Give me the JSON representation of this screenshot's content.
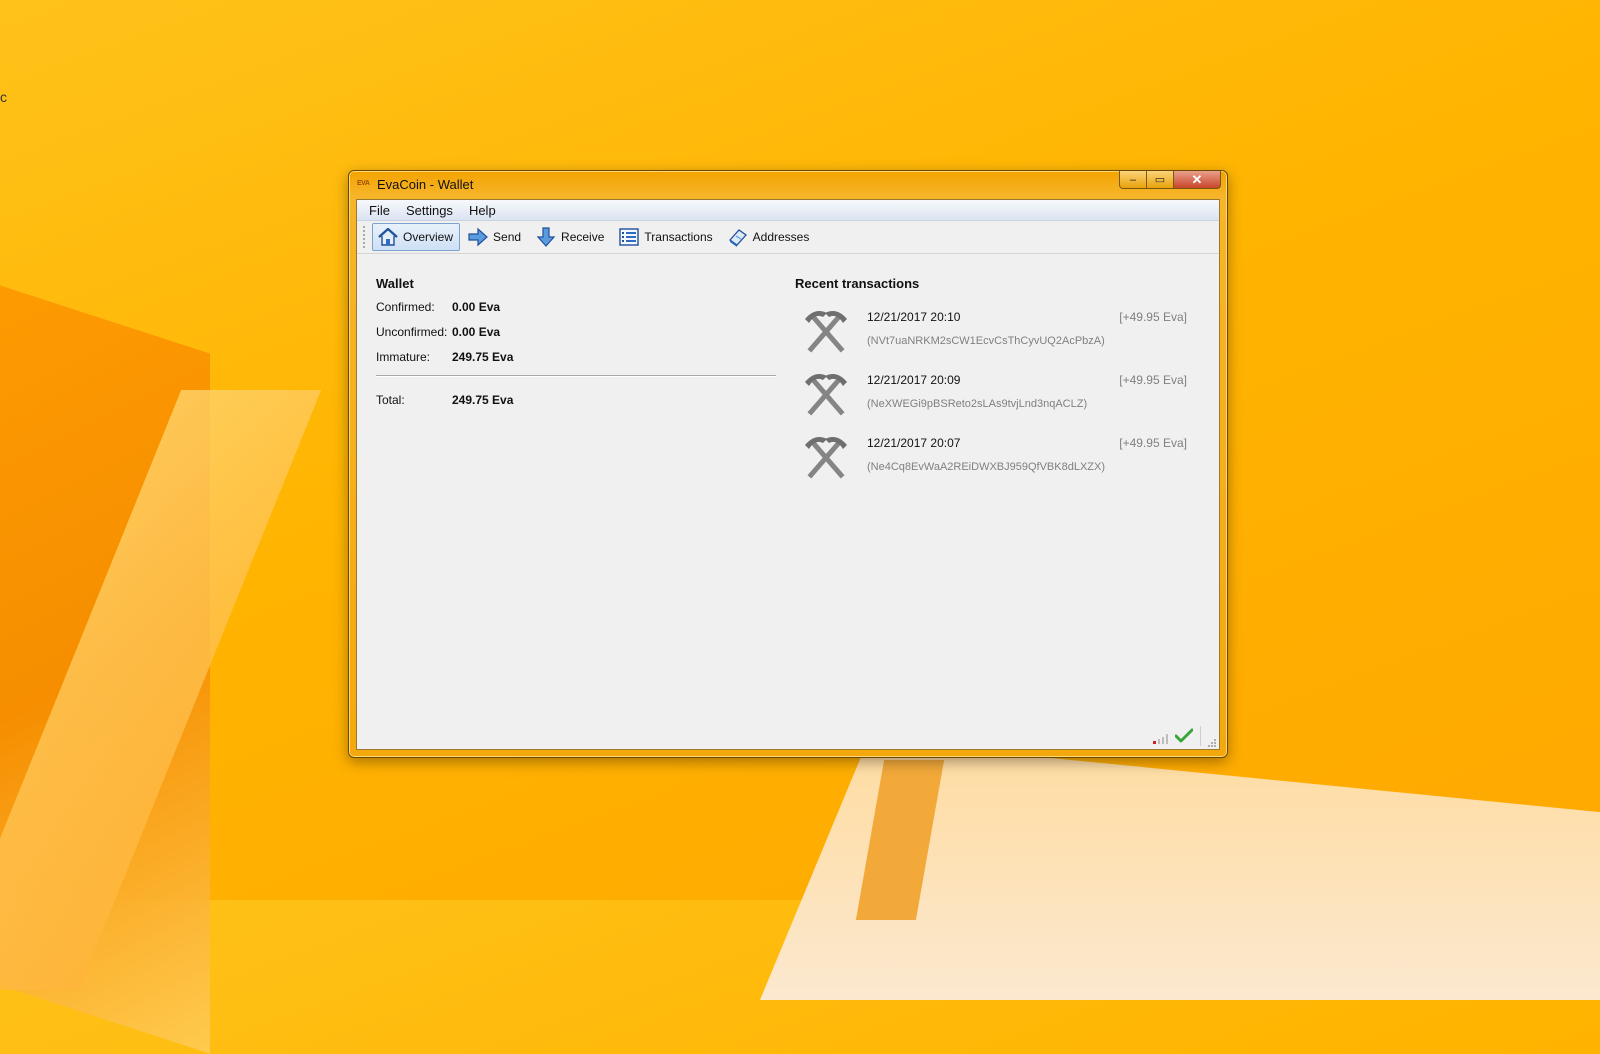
{
  "desktop": {
    "glyph": "c"
  },
  "window": {
    "title": "EvaCoin - Wallet",
    "app_icon_text": "EVA",
    "caption": {
      "minimize": "–",
      "maximize": "▭",
      "close": "✕"
    }
  },
  "menu": {
    "items": [
      "File",
      "Settings",
      "Help"
    ]
  },
  "toolbar": {
    "items": [
      {
        "label": "Overview",
        "icon": "home-icon",
        "active": true
      },
      {
        "label": "Send",
        "icon": "send-arrow-icon",
        "active": false
      },
      {
        "label": "Receive",
        "icon": "receive-arrow-icon",
        "active": false
      },
      {
        "label": "Transactions",
        "icon": "list-icon",
        "active": false
      },
      {
        "label": "Addresses",
        "icon": "address-book-icon",
        "active": false
      }
    ]
  },
  "wallet": {
    "title": "Wallet",
    "confirmed": {
      "label": "Confirmed:",
      "value": "0.00 Eva"
    },
    "unconfirmed": {
      "label": "Unconfirmed:",
      "value": "0.00 Eva"
    },
    "immature": {
      "label": "Immature:",
      "value": "249.75 Eva"
    },
    "total": {
      "label": "Total:",
      "value": "249.75 Eva"
    }
  },
  "recent": {
    "title": "Recent transactions",
    "transactions": [
      {
        "date": "12/21/2017 20:10",
        "amount": "[+49.95 Eva]",
        "address": "(NVt7uaNRKM2sCW1EcvCsThCyvUQ2AcPbzA)",
        "icon": "mining-pickaxes-icon"
      },
      {
        "date": "12/21/2017 20:09",
        "amount": "[+49.95 Eva]",
        "address": "(NeXWEGi9pBSReto2sLAs9tvjLnd3nqACLZ)",
        "icon": "mining-pickaxes-icon"
      },
      {
        "date": "12/21/2017 20:07",
        "amount": "[+49.95 Eva]",
        "address": "(Ne4Cq8EvWaA2REiDWXBJ959QfVBK8dLXZX)",
        "icon": "mining-pickaxes-icon"
      }
    ]
  },
  "status": {
    "sync_icon": "signal-bars-icon",
    "check_icon": "checkmark-icon",
    "check_color": "#3aa53a"
  }
}
